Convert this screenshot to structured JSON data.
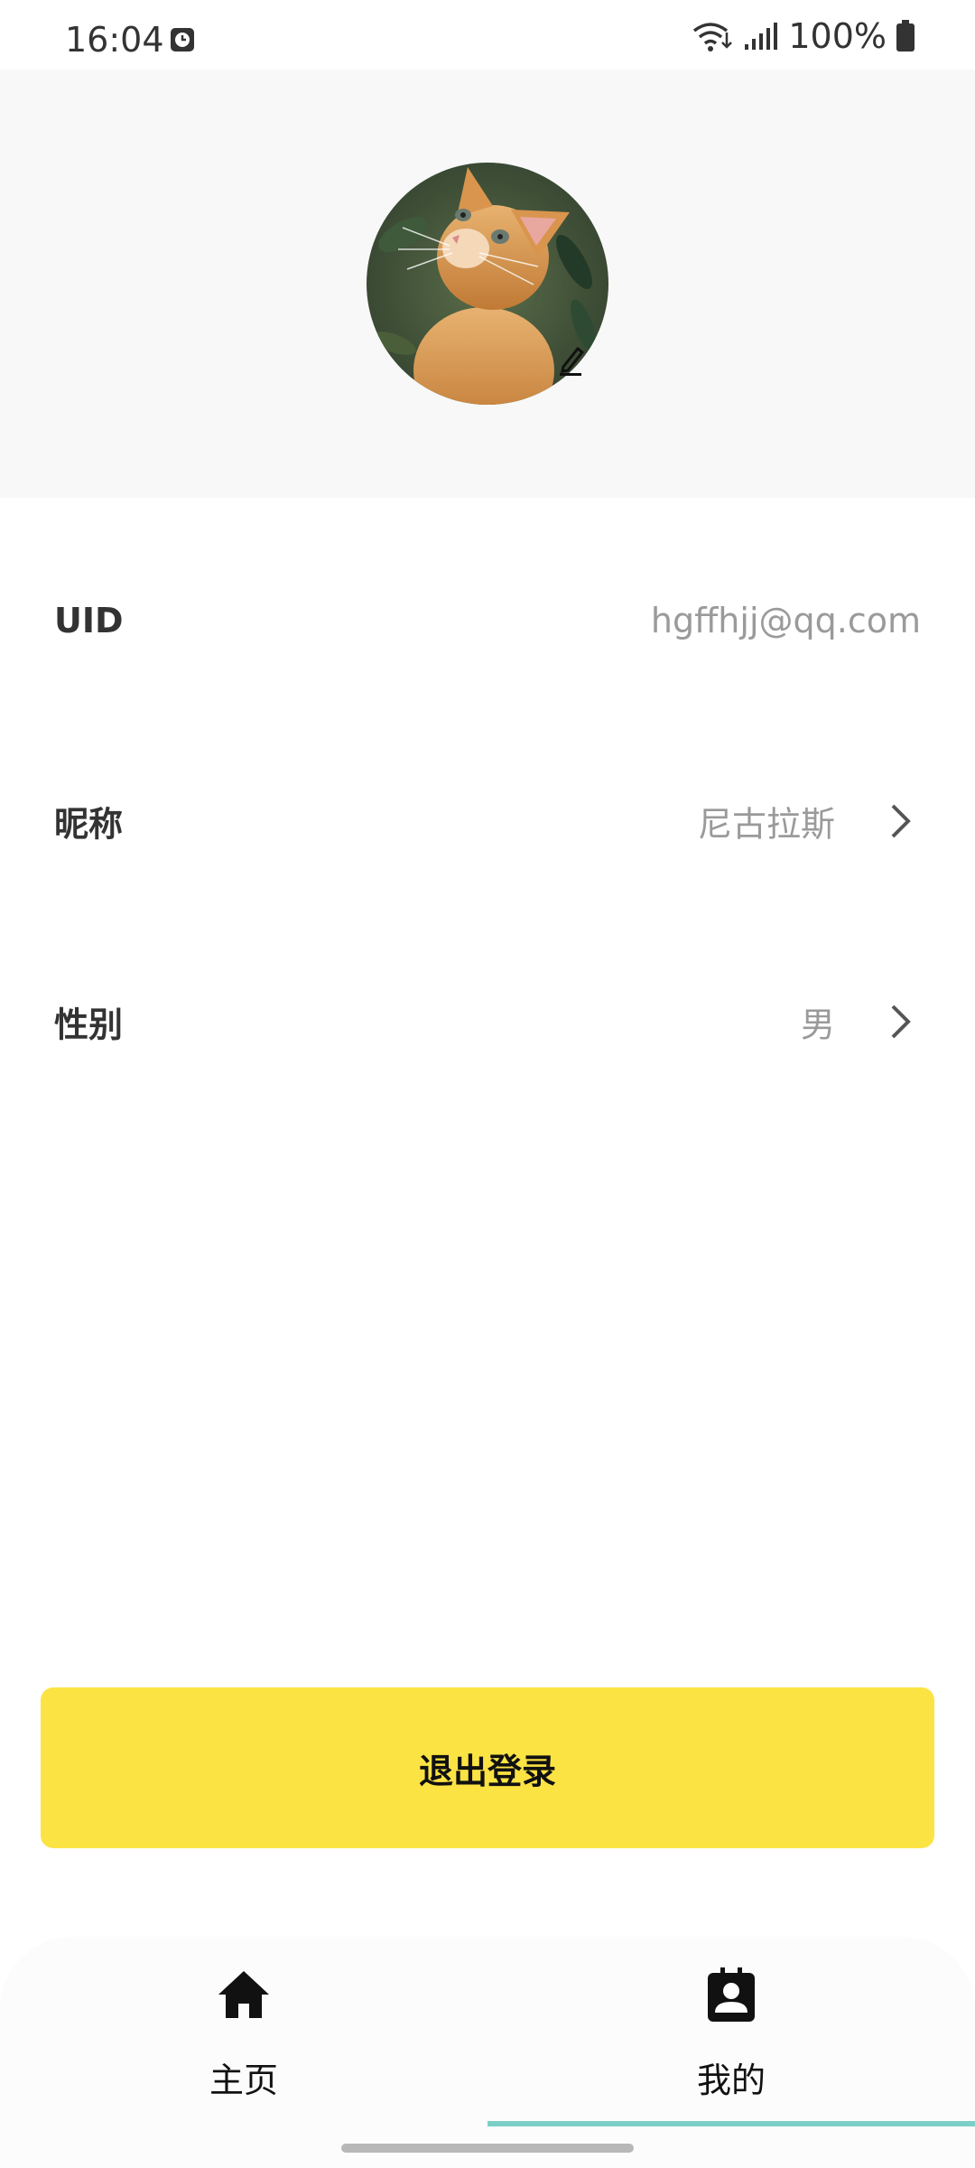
{
  "status_bar": {
    "time": "16:04",
    "battery": "100%",
    "icons": [
      "alarm-icon",
      "wifi-icon",
      "signal-icon",
      "battery-icon"
    ]
  },
  "profile": {
    "avatar_icon": "cat-avatar",
    "edit_icon": "pencil-icon",
    "rows": [
      {
        "label": "UID",
        "value": "hgffhjj@qq.com",
        "has_chevron": false
      },
      {
        "label": "昵称",
        "value": "尼古拉斯",
        "has_chevron": true
      },
      {
        "label": "性别",
        "value": "男",
        "has_chevron": true
      }
    ]
  },
  "logout": {
    "label": "退出登录"
  },
  "bottom_nav": {
    "items": [
      {
        "label": "主页",
        "icon": "home-icon",
        "active": false
      },
      {
        "label": "我的",
        "icon": "contact-card-icon",
        "active": true
      }
    ]
  },
  "colors": {
    "accent_yellow": "#fce344",
    "nav_indicator": "#7ccfc6",
    "header_bg": "#f8f8f8"
  }
}
